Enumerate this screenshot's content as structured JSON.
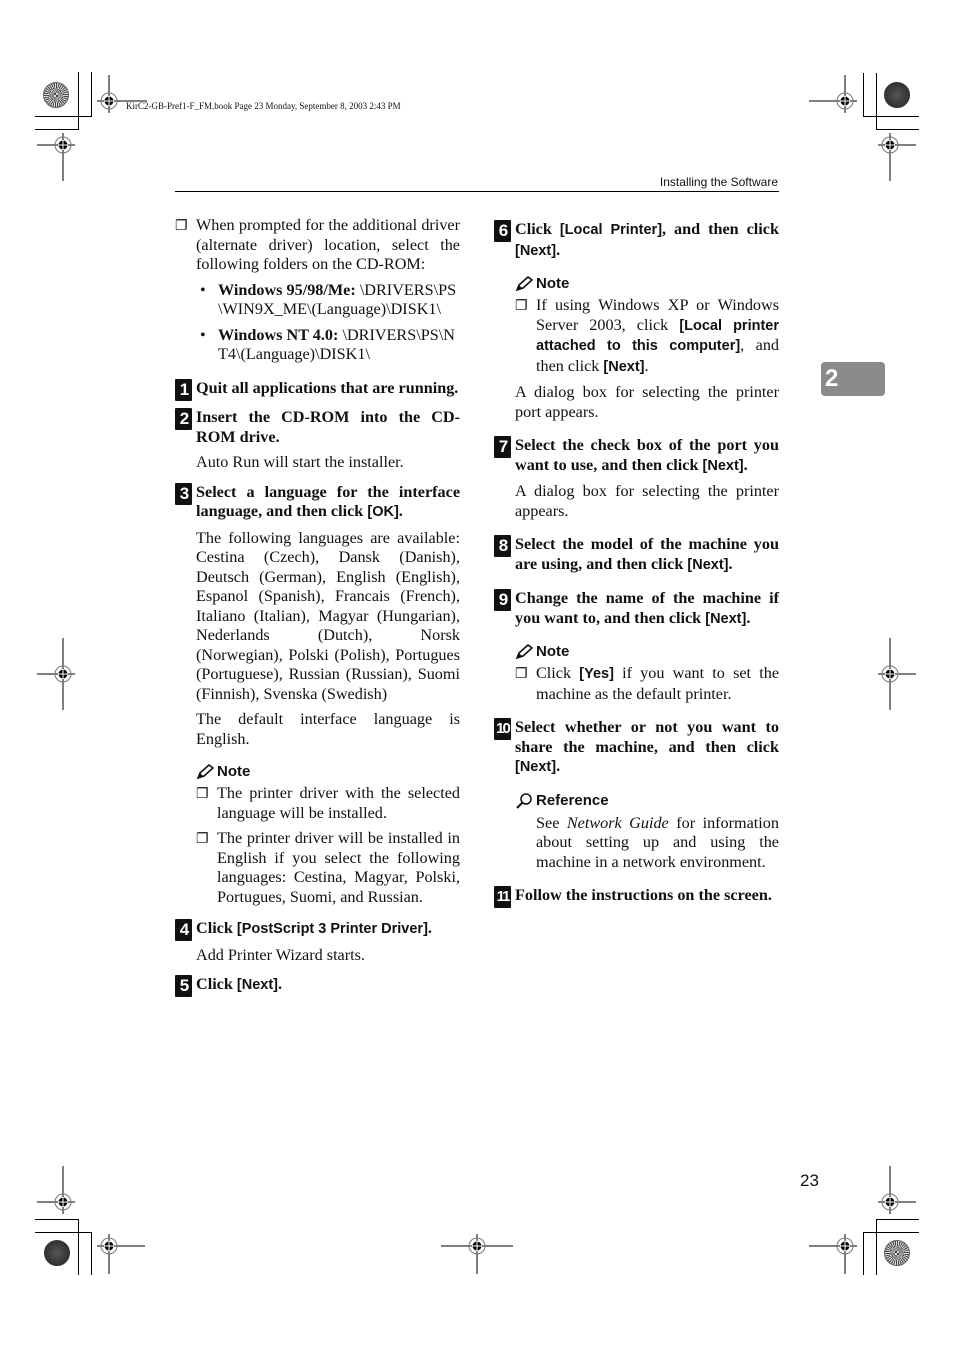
{
  "print_info": "KirC2-GB-Pref1-F_FM.book  Page 23  Monday, September 8, 2003  2:43 PM",
  "running_head": "Installing the Software",
  "chapter_tab": "2",
  "page_number": "23",
  "left_column": {
    "intro_bullet": {
      "text": "When prompted for the additional driver (alternate driver) location, select the following folders on the CD-ROM:",
      "paths": [
        {
          "label": "Windows 95/98/Me:",
          "path": " \\DRIVERS\\PS\\WIN9X_ME\\(Language)\\DISK1\\"
        },
        {
          "label": "Windows NT 4.0:",
          "path": " \\DRIVERS\\PS\\NT4\\(Language)\\DISK1\\"
        }
      ]
    },
    "steps": [
      {
        "num": "1",
        "title": "Quit all applications that are running."
      },
      {
        "num": "2",
        "title": "Insert the CD-ROM into the CD-ROM drive.",
        "body": "Auto Run will start the installer."
      },
      {
        "num": "3",
        "title_pre": "Select a language for the interface language, and then click ",
        "title_kw": "[OK]",
        "title_post": ".",
        "body1": "The following languages are available: Cestina (Czech), Dansk (Danish), Deutsch (German), English (English), Espanol (Spanish), Francais (French), Italiano (Italian), Magyar (Hungarian), Nederlands (Dutch), Norsk (Norwegian), Polski (Polish), Portugues (Portuguese), Russian (Russian), Suomi (Finnish), Svenska (Swedish)",
        "body2": "The default interface language is English.",
        "note_label": "Note",
        "notes": [
          "The printer driver with the selected language will be installed.",
          "The printer driver will be installed in English if you select the following languages: Cestina, Magyar, Polski, Portugues, Suomi, and Russian."
        ]
      },
      {
        "num": "4",
        "title_pre": "Click ",
        "title_kw": "[PostScript 3 Printer Driver]",
        "title_post": ".",
        "body": "Add Printer Wizard starts."
      },
      {
        "num": "5",
        "title_pre": "Click ",
        "title_kw": "[Next]",
        "title_post": "."
      }
    ]
  },
  "right_column": {
    "steps": [
      {
        "num": "6",
        "title_pre": "Click ",
        "title_kw": "[Local Printer]",
        "title_mid": ", and then click ",
        "title_kw2": "[Next]",
        "title_post": ".",
        "note_label": "Note",
        "note_pre": "If using Windows XP or Windows Server 2003, click ",
        "note_kw": "[Local printer attached to this computer]",
        "note_mid": ", and then click ",
        "note_kw2": "[Next]",
        "note_post": ".",
        "body": "A dialog box for selecting the printer port appears."
      },
      {
        "num": "7",
        "title_pre": "Select the check box of the port you want to use, and then click ",
        "title_kw": "[Next]",
        "title_post": ".",
        "body": "A dialog box for selecting the printer appears."
      },
      {
        "num": "8",
        "title_pre": "Select the model of the machine you are using, and then click ",
        "title_kw": "[Next]",
        "title_post": "."
      },
      {
        "num": "9",
        "title_pre": "Change the name of the machine if you want to, and then click ",
        "title_kw": "[Next]",
        "title_post": ".",
        "note_label": "Note",
        "note_pre": "Click ",
        "note_kw": "[Yes]",
        "note_post": " if you want to set the machine as the default printer."
      },
      {
        "num": "10",
        "title_pre": "Select whether or not you want to share the machine, and then click ",
        "title_kw": "[Next]",
        "title_post": ".",
        "ref_label": "Reference",
        "ref_pre": "See ",
        "ref_em": "Network Guide",
        "ref_post": " for information about setting up and using the machine in a network environment."
      },
      {
        "num": "11",
        "title": "Follow the instructions on the screen."
      }
    ]
  },
  "icons": {
    "checkbox_bullet": "❐",
    "dot_bullet": "•"
  }
}
